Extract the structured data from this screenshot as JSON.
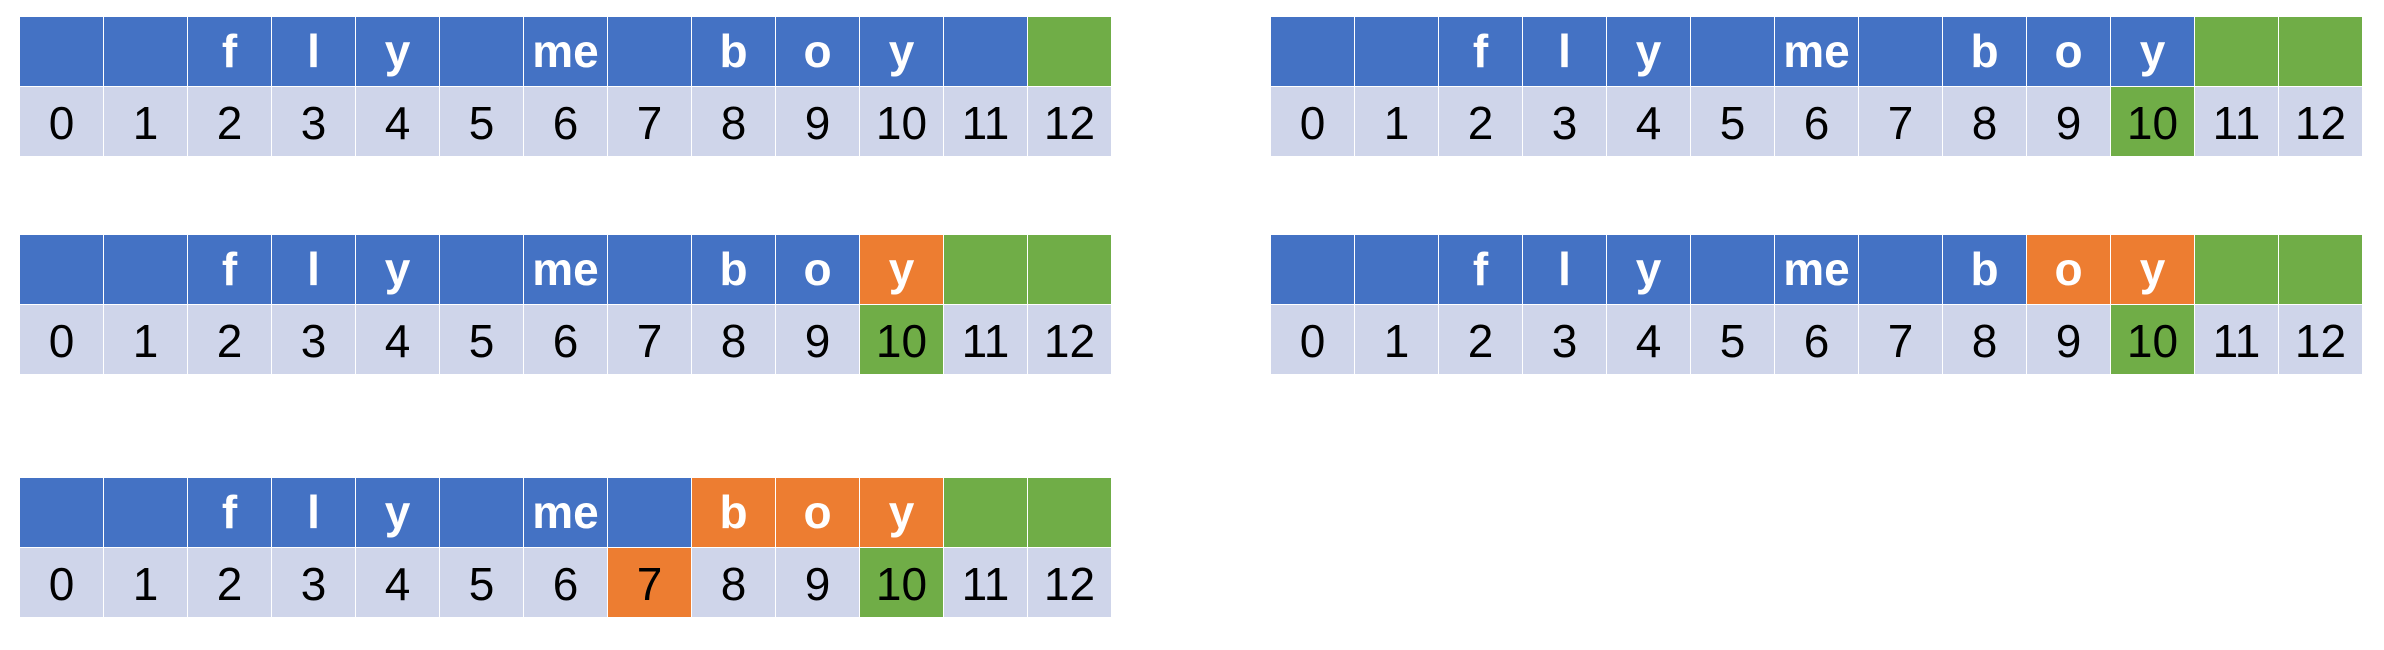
{
  "colors": {
    "blue": "#4472C4",
    "green": "#70AD47",
    "orange": "#ED7D31",
    "light": "#CFD5EA"
  },
  "diagrams": [
    {
      "chars": [
        {
          "t": "",
          "c": "blue"
        },
        {
          "t": "",
          "c": "blue"
        },
        {
          "t": "f",
          "c": "blue"
        },
        {
          "t": "l",
          "c": "blue"
        },
        {
          "t": "y",
          "c": "blue"
        },
        {
          "t": "",
          "c": "blue"
        },
        {
          "t": "me",
          "c": "blue"
        },
        {
          "t": "",
          "c": "blue"
        },
        {
          "t": "b",
          "c": "blue"
        },
        {
          "t": "o",
          "c": "blue"
        },
        {
          "t": "y",
          "c": "blue"
        },
        {
          "t": "",
          "c": "blue"
        },
        {
          "t": "",
          "c": "green"
        }
      ],
      "indices": [
        {
          "t": "0",
          "c": "light"
        },
        {
          "t": "1",
          "c": "light"
        },
        {
          "t": "2",
          "c": "light"
        },
        {
          "t": "3",
          "c": "light"
        },
        {
          "t": "4",
          "c": "light"
        },
        {
          "t": "5",
          "c": "light"
        },
        {
          "t": "6",
          "c": "light"
        },
        {
          "t": "7",
          "c": "light"
        },
        {
          "t": "8",
          "c": "light"
        },
        {
          "t": "9",
          "c": "light"
        },
        {
          "t": "10",
          "c": "light"
        },
        {
          "t": "11",
          "c": "light"
        },
        {
          "t": "12",
          "c": "light"
        }
      ]
    },
    {
      "chars": [
        {
          "t": "",
          "c": "blue"
        },
        {
          "t": "",
          "c": "blue"
        },
        {
          "t": "f",
          "c": "blue"
        },
        {
          "t": "l",
          "c": "blue"
        },
        {
          "t": "y",
          "c": "blue"
        },
        {
          "t": "",
          "c": "blue"
        },
        {
          "t": "me",
          "c": "blue"
        },
        {
          "t": "",
          "c": "blue"
        },
        {
          "t": "b",
          "c": "blue"
        },
        {
          "t": "o",
          "c": "blue"
        },
        {
          "t": "y",
          "c": "blue"
        },
        {
          "t": "",
          "c": "green"
        },
        {
          "t": "",
          "c": "green"
        }
      ],
      "indices": [
        {
          "t": "0",
          "c": "light"
        },
        {
          "t": "1",
          "c": "light"
        },
        {
          "t": "2",
          "c": "light"
        },
        {
          "t": "3",
          "c": "light"
        },
        {
          "t": "4",
          "c": "light"
        },
        {
          "t": "5",
          "c": "light"
        },
        {
          "t": "6",
          "c": "light"
        },
        {
          "t": "7",
          "c": "light"
        },
        {
          "t": "8",
          "c": "light"
        },
        {
          "t": "9",
          "c": "light"
        },
        {
          "t": "10",
          "c": "green"
        },
        {
          "t": "11",
          "c": "light"
        },
        {
          "t": "12",
          "c": "light"
        }
      ]
    },
    {
      "chars": [
        {
          "t": "",
          "c": "blue"
        },
        {
          "t": "",
          "c": "blue"
        },
        {
          "t": "f",
          "c": "blue"
        },
        {
          "t": "l",
          "c": "blue"
        },
        {
          "t": "y",
          "c": "blue"
        },
        {
          "t": "",
          "c": "blue"
        },
        {
          "t": "me",
          "c": "blue"
        },
        {
          "t": "",
          "c": "blue"
        },
        {
          "t": "b",
          "c": "blue"
        },
        {
          "t": "o",
          "c": "blue"
        },
        {
          "t": "y",
          "c": "orange"
        },
        {
          "t": "",
          "c": "green"
        },
        {
          "t": "",
          "c": "green"
        }
      ],
      "indices": [
        {
          "t": "0",
          "c": "light"
        },
        {
          "t": "1",
          "c": "light"
        },
        {
          "t": "2",
          "c": "light"
        },
        {
          "t": "3",
          "c": "light"
        },
        {
          "t": "4",
          "c": "light"
        },
        {
          "t": "5",
          "c": "light"
        },
        {
          "t": "6",
          "c": "light"
        },
        {
          "t": "7",
          "c": "light"
        },
        {
          "t": "8",
          "c": "light"
        },
        {
          "t": "9",
          "c": "light"
        },
        {
          "t": "10",
          "c": "green"
        },
        {
          "t": "11",
          "c": "light"
        },
        {
          "t": "12",
          "c": "light"
        }
      ]
    },
    {
      "chars": [
        {
          "t": "",
          "c": "blue"
        },
        {
          "t": "",
          "c": "blue"
        },
        {
          "t": "f",
          "c": "blue"
        },
        {
          "t": "l",
          "c": "blue"
        },
        {
          "t": "y",
          "c": "blue"
        },
        {
          "t": "",
          "c": "blue"
        },
        {
          "t": "me",
          "c": "blue"
        },
        {
          "t": "",
          "c": "blue"
        },
        {
          "t": "b",
          "c": "blue"
        },
        {
          "t": "o",
          "c": "orange"
        },
        {
          "t": "y",
          "c": "orange"
        },
        {
          "t": "",
          "c": "green"
        },
        {
          "t": "",
          "c": "green"
        }
      ],
      "indices": [
        {
          "t": "0",
          "c": "light"
        },
        {
          "t": "1",
          "c": "light"
        },
        {
          "t": "2",
          "c": "light"
        },
        {
          "t": "3",
          "c": "light"
        },
        {
          "t": "4",
          "c": "light"
        },
        {
          "t": "5",
          "c": "light"
        },
        {
          "t": "6",
          "c": "light"
        },
        {
          "t": "7",
          "c": "light"
        },
        {
          "t": "8",
          "c": "light"
        },
        {
          "t": "9",
          "c": "light"
        },
        {
          "t": "10",
          "c": "green"
        },
        {
          "t": "11",
          "c": "light"
        },
        {
          "t": "12",
          "c": "light"
        }
      ]
    },
    {
      "chars": [
        {
          "t": "",
          "c": "blue"
        },
        {
          "t": "",
          "c": "blue"
        },
        {
          "t": "f",
          "c": "blue"
        },
        {
          "t": "l",
          "c": "blue"
        },
        {
          "t": "y",
          "c": "blue"
        },
        {
          "t": "",
          "c": "blue"
        },
        {
          "t": "me",
          "c": "blue"
        },
        {
          "t": "",
          "c": "blue"
        },
        {
          "t": "b",
          "c": "orange"
        },
        {
          "t": "o",
          "c": "orange"
        },
        {
          "t": "y",
          "c": "orange"
        },
        {
          "t": "",
          "c": "green"
        },
        {
          "t": "",
          "c": "green"
        }
      ],
      "indices": [
        {
          "t": "0",
          "c": "light"
        },
        {
          "t": "1",
          "c": "light"
        },
        {
          "t": "2",
          "c": "light"
        },
        {
          "t": "3",
          "c": "light"
        },
        {
          "t": "4",
          "c": "light"
        },
        {
          "t": "5",
          "c": "light"
        },
        {
          "t": "6",
          "c": "light"
        },
        {
          "t": "7",
          "c": "orange"
        },
        {
          "t": "8",
          "c": "light"
        },
        {
          "t": "9",
          "c": "light"
        },
        {
          "t": "10",
          "c": "green"
        },
        {
          "t": "11",
          "c": "light"
        },
        {
          "t": "12",
          "c": "light"
        }
      ]
    }
  ]
}
